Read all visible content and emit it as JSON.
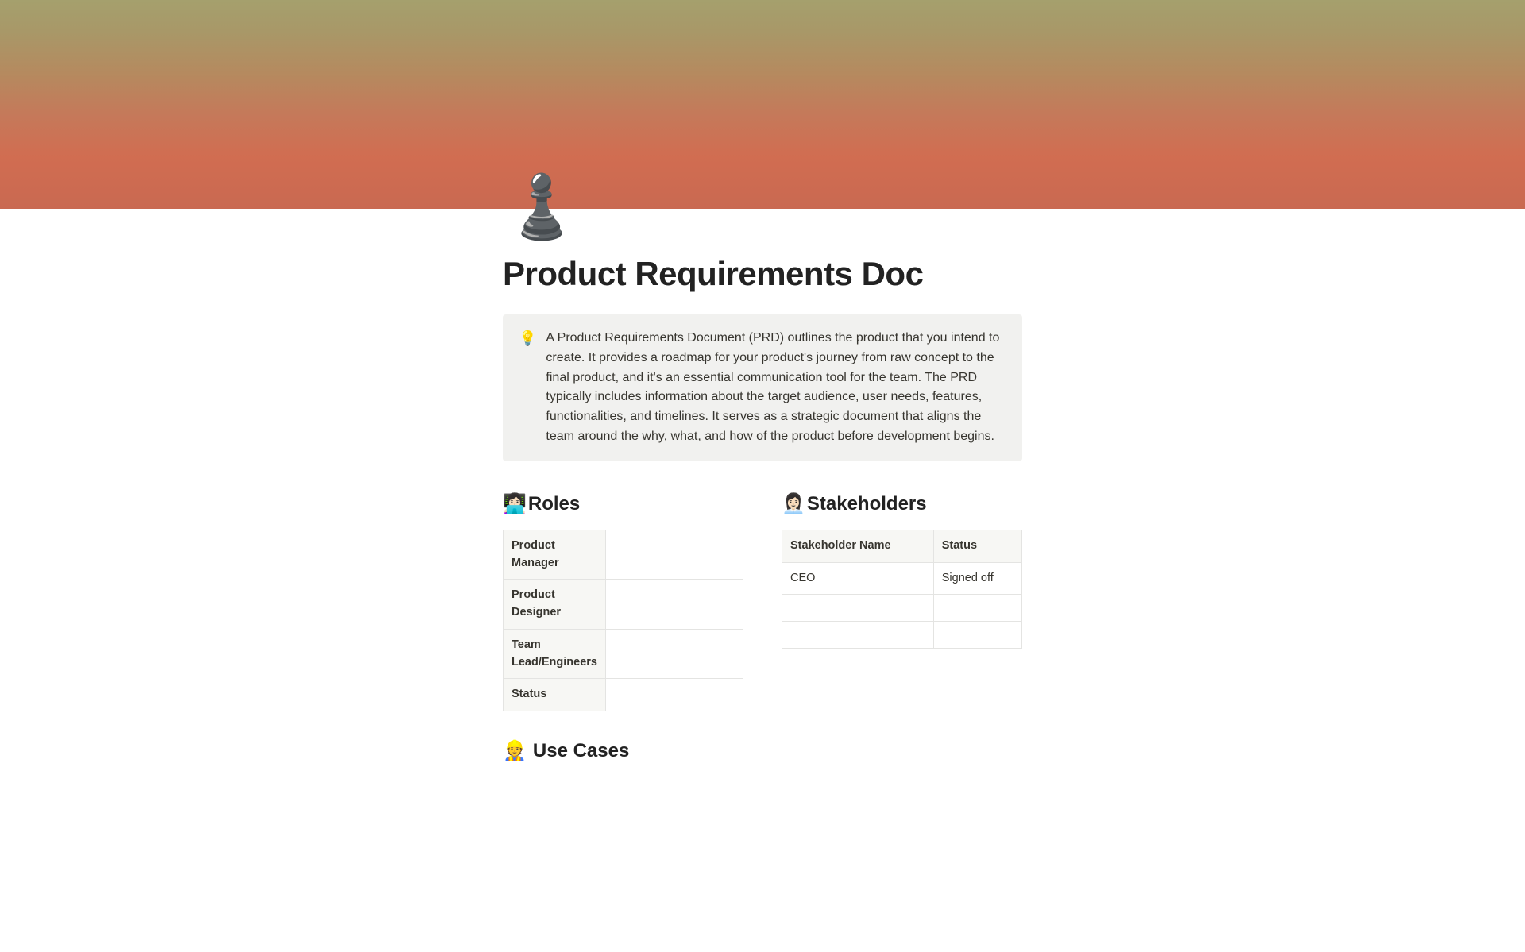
{
  "page": {
    "icon": "♟️",
    "title": "Product Requirements Doc"
  },
  "callout": {
    "icon": "💡",
    "text": "A Product Requirements Document (PRD) outlines the product that you intend to create. It provides a roadmap for your product's journey from raw concept to the final product, and it's an essential communication tool for the team. The PRD typically includes information about the target audience, user needs, features, functionalities, and timelines. It serves as a strategic document that aligns the team around the why, what, and how of the product before development begins."
  },
  "roles": {
    "icon": "👩🏻‍💻",
    "heading": "Roles",
    "rows": [
      {
        "label": "Product Manager",
        "value": ""
      },
      {
        "label": "Product Designer",
        "value": ""
      },
      {
        "label": "Team Lead/Engineers",
        "value": ""
      },
      {
        "label": "Status",
        "value": ""
      }
    ]
  },
  "stakeholders": {
    "icon": "👩🏻‍💼",
    "heading": "Stakeholders",
    "columns": [
      "Stakeholder Name",
      "Status"
    ],
    "rows": [
      {
        "name": "CEO",
        "status": "Signed off"
      },
      {
        "name": "",
        "status": ""
      },
      {
        "name": "",
        "status": ""
      }
    ]
  },
  "use_cases": {
    "icon": "👷",
    "heading": "Use Cases"
  }
}
